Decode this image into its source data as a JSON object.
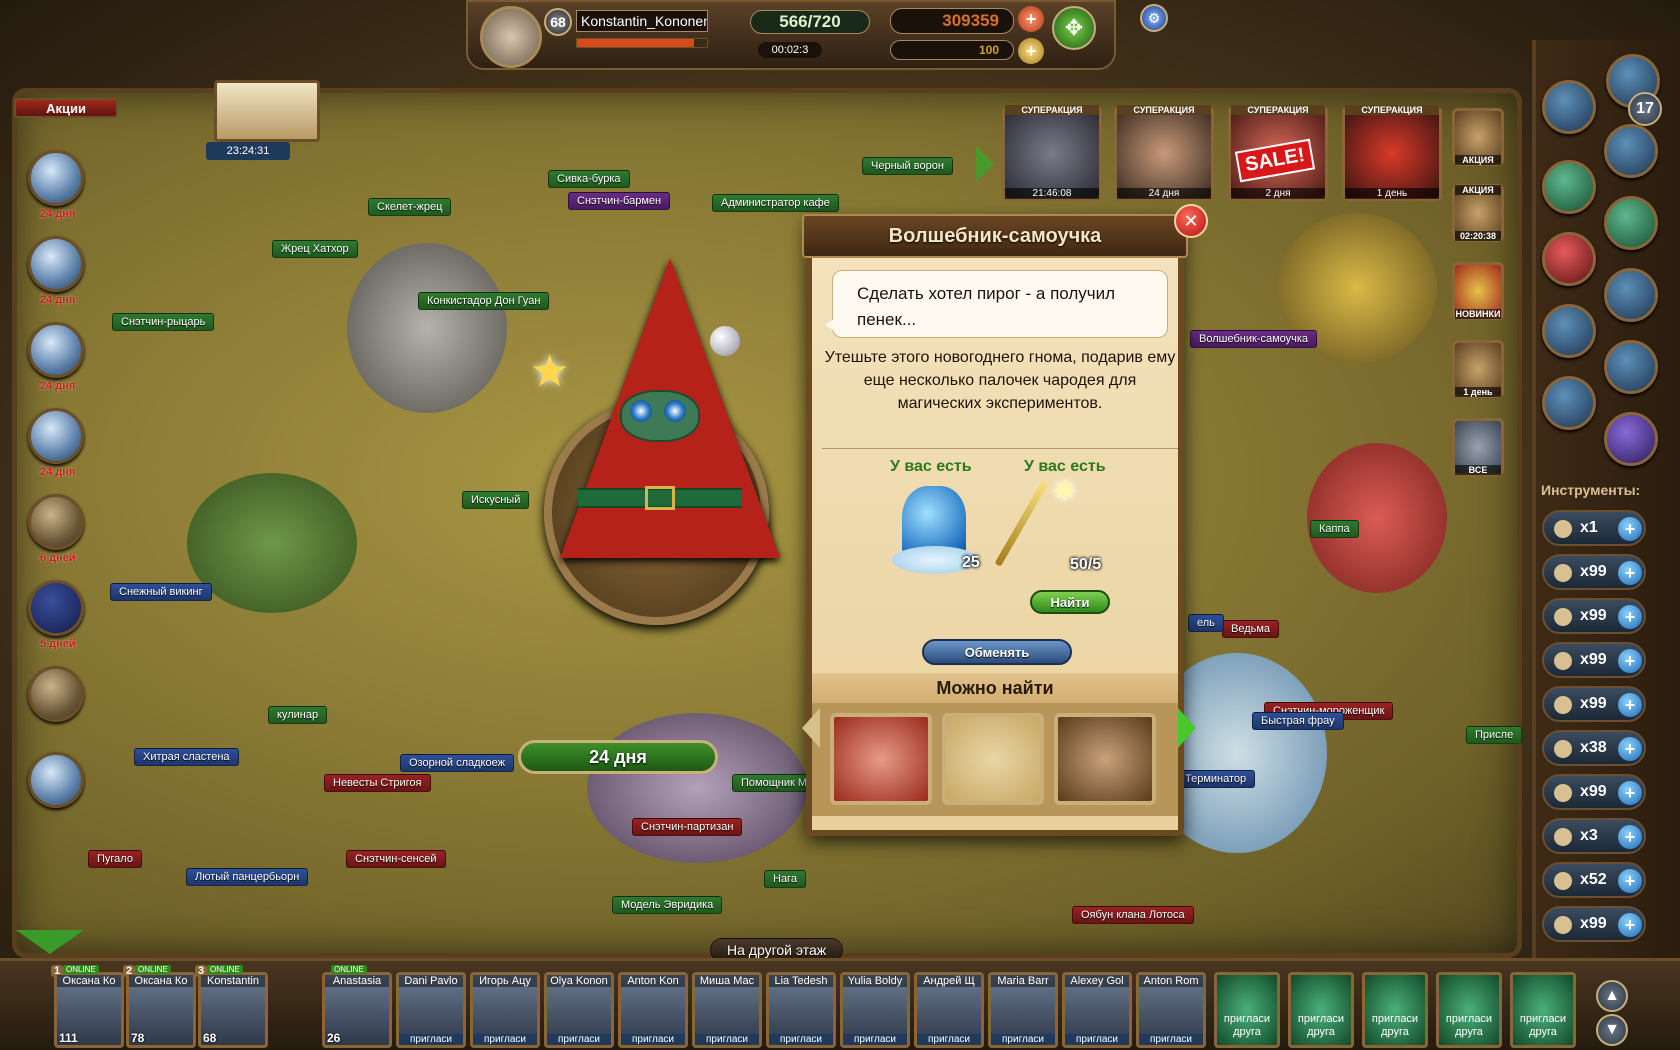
{
  "player": {
    "level": "68",
    "name": "Konstantin_Kononen",
    "energy": "566/720",
    "energy_timer": "00:02:3",
    "coins": "309359",
    "exp": "100"
  },
  "promo_label": "Акции",
  "timer_book": "23:24:31",
  "left_days": [
    "24 дня",
    "24 дня",
    "24 дня",
    "24 дня",
    "6 дней",
    "5 дней"
  ],
  "map_labels": {
    "sivka": "Сивка-бурка",
    "skelet": "Скелет-жрец",
    "barmen": "Снэтчин-бармен",
    "admin": "Администратор кафе",
    "raven": "Черный ворон",
    "hathor": "Жрец Хатхор",
    "donguan": "Конкистадор Дон Гуан",
    "knight": "Снэтчин-рыцарь",
    "skilled": "Искусный",
    "viking": "Снежный викинг",
    "culinar": "кулинар",
    "sweet": "Хитрая сластена",
    "sweet2": "Озорной сладкоеж",
    "brides": "Невесты Стригоя",
    "pugalo": "Пугало",
    "sensei": "Снэтчин-сенсей",
    "bear": "Лютый панцербьорн",
    "partisan": "Снэтчин-партизан",
    "helper": "Помощник М",
    "naga": "Нага",
    "euridika": "Модель Эвридика",
    "witch": "Ведьма",
    "kappa": "Каппа",
    "icecream": "Снэтчин-мороженщик",
    "lotus": "Оябун клана Лотоса",
    "terminator": "Терминатор",
    "other_floor": "На другой этаж",
    "gnome": "Волшебник-самоучка",
    "prisp": "Присле",
    "stel": "ель",
    "bistr": "Быстрая фрау"
  },
  "super_actions": {
    "header": "СУПЕРАКЦИЯ",
    "timers": [
      "21:46:08",
      "24 дня",
      "2 дня",
      "1 день"
    ],
    "sale": "SALE!"
  },
  "side_actions": {
    "a1": "АКЦИЯ",
    "a2": "АКЦИЯ",
    "a2_timer": "02:20:38",
    "new": "НОВИНКИ",
    "day": "1 день",
    "all": "ВСЕ"
  },
  "right_badge": "17",
  "dialog": {
    "title": "Волшебник-самоучка",
    "bubble": "Сделать хотел пирог - а получил пенек...",
    "description": "Утешьте этого новогоднего гнома, подарив ему еще несколько палочек чародея для магических экспериментов.",
    "have_label": "У вас есть",
    "item1_count": "25",
    "item2_count": "50/5",
    "find_button": "Найти",
    "exchange_button": "Обменять",
    "can_find_label": "Можно найти"
  },
  "days_badge": "24 дня",
  "tools_title": "Инструменты:",
  "tools": [
    {
      "q": "x1"
    },
    {
      "q": "x99"
    },
    {
      "q": "x99"
    },
    {
      "q": "x99"
    },
    {
      "q": "x99"
    },
    {
      "q": "x38"
    },
    {
      "q": "x99"
    },
    {
      "q": "x3"
    },
    {
      "q": "x52"
    },
    {
      "q": "x99"
    }
  ],
  "friends": [
    {
      "name": "Оксана Ко",
      "level": "111",
      "rank": "1",
      "online": "ONLINE"
    },
    {
      "name": "Оксана Ко",
      "level": "78",
      "rank": "2",
      "online": "ONLINE"
    },
    {
      "name": "Konstantin",
      "level": "68",
      "rank": "3",
      "online": "ONLINE"
    },
    {
      "name": "Anastasia",
      "level": "26",
      "online": "ONLINE"
    },
    {
      "name": "Dani Pavlo",
      "invite": "пригласи"
    },
    {
      "name": "Игорь Ацу",
      "invite": "пригласи"
    },
    {
      "name": "Olya Konon",
      "invite": "пригласи"
    },
    {
      "name": "Anton Kon",
      "invite": "пригласи"
    },
    {
      "name": "Миша Мас",
      "invite": "пригласи"
    },
    {
      "name": "Lia Tedesh",
      "invite": "пригласи"
    },
    {
      "name": "Yulia Boldy",
      "invite": "пригласи"
    },
    {
      "name": "Андрей Щ",
      "invite": "пригласи"
    },
    {
      "name": "Maria Barr",
      "invite": "пригласи"
    },
    {
      "name": "Alexey Gol",
      "invite": "пригласи"
    },
    {
      "name": "Anton Rom",
      "invite": "пригласи"
    }
  ],
  "invite_friend": {
    "l1": "пригласи",
    "l2": "друга"
  }
}
